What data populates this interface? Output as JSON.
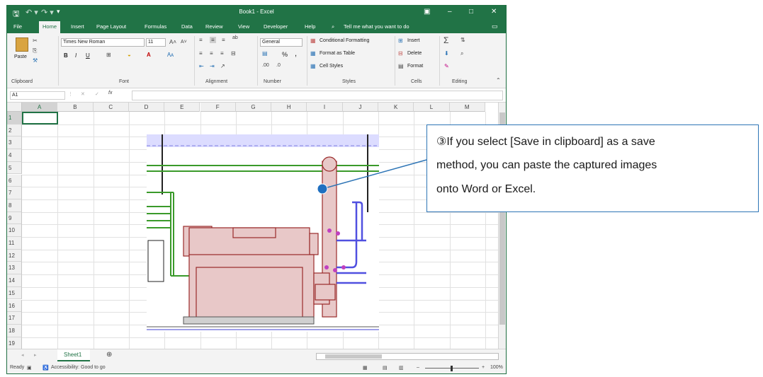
{
  "titlebar": {
    "title": "Book1 - Excel",
    "qat_save_icon": "save-icon",
    "qat_undo_icon": "undo-icon",
    "qat_redo_icon": "redo-icon"
  },
  "tabs": [
    "File",
    "Home",
    "Insert",
    "Page Layout",
    "Formulas",
    "Data",
    "Review",
    "View",
    "Developer",
    "Help"
  ],
  "tell_me": "Tell me what you want to do",
  "ribbon": {
    "clipboard": {
      "paste": "Paste",
      "label": "Clipboard"
    },
    "font": {
      "name": "Times New Roman",
      "size": "11",
      "label": "Font",
      "bold": "B",
      "italic": "I",
      "underline": "U"
    },
    "alignment": {
      "label": "Alignment"
    },
    "number": {
      "format": "General",
      "label": "Number",
      "percent": "%",
      "comma": ","
    },
    "styles": {
      "conditional": "Conditional Formatting",
      "format_table": "Format as Table",
      "cell_styles": "Cell Styles",
      "label": "Styles"
    },
    "cells": {
      "insert": "Insert",
      "delete": "Delete",
      "format": "Format",
      "label": "Cells"
    },
    "editing": {
      "label": "Editing"
    }
  },
  "formula_bar": {
    "name_box": "A1",
    "fx": "fx"
  },
  "columns": [
    "A",
    "B",
    "C",
    "D",
    "E",
    "F",
    "G",
    "H",
    "I",
    "J",
    "K",
    "L",
    "M"
  ],
  "rows": [
    "1",
    "2",
    "3",
    "4",
    "5",
    "6",
    "7",
    "8",
    "9",
    "10",
    "11",
    "12",
    "13",
    "14",
    "15",
    "16",
    "17",
    "18",
    "19"
  ],
  "sheet_tab": "Sheet1",
  "status": {
    "ready": "Ready",
    "accessibility": "Accessibility: Good to go",
    "zoom": "100%"
  },
  "callout": {
    "line1": "③If you select [Save in clipboard] as a save",
    "line2": "method, you can paste the captured images",
    "line3": "onto Word or Excel."
  },
  "colors": {
    "excel_green": "#217346",
    "callout_border": "#2e75b6",
    "marker": "#1f6fc0"
  }
}
